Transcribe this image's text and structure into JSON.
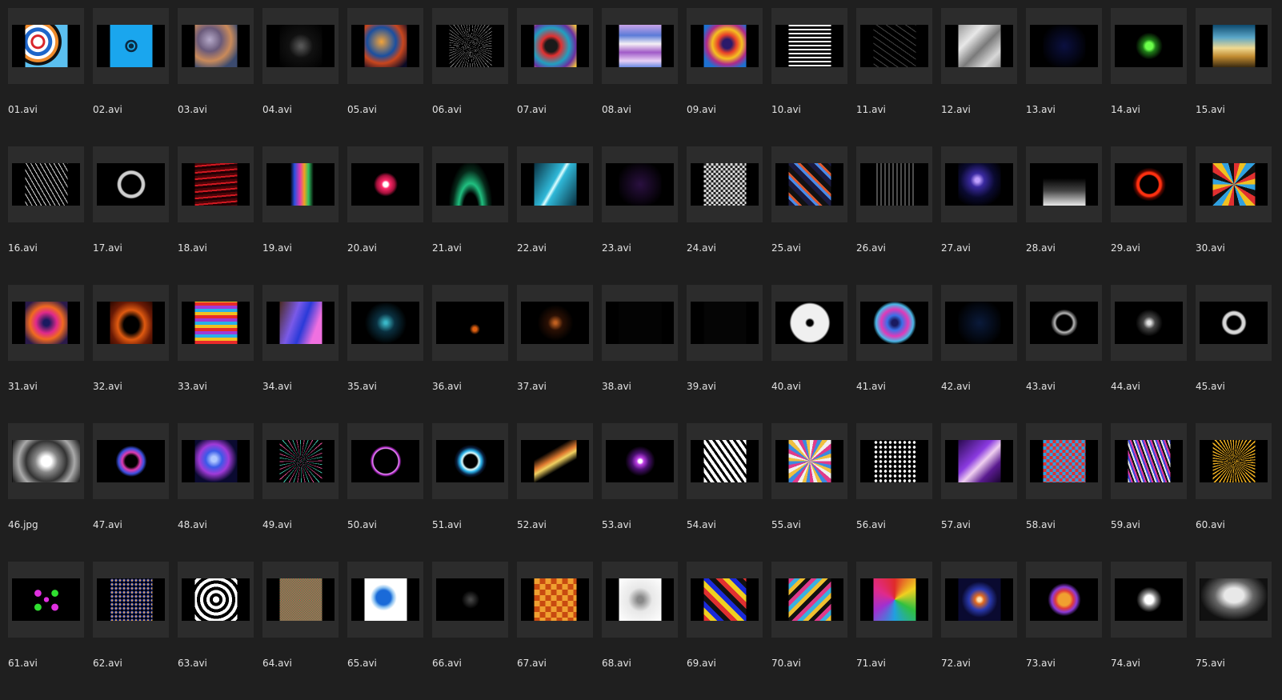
{
  "files": [
    {
      "name": "01.avi",
      "art": "thumbnail-art",
      "bg": "radial-gradient(circle at 30% 40%, #ffffff 0 12%, #d8252a 13% 18%, #ffffff 19% 26%, #1e66c9 27% 36%, #ffffff 37% 44%, #ef8b2c 45% 52%, #111 53% 60%, #5bc0f0 61% 100%)"
    },
    {
      "name": "02.avi",
      "art": "thumbnail-art",
      "bg": "radial-gradient(circle, #0a2a40 0 8%, #1aa8e8 9% 13%, #0b2b44 14% 20%, #1aa6ee 21% 100%)"
    },
    {
      "name": "03.avi",
      "art": "thumbnail-art",
      "bg": "radial-gradient(circle at 35% 35%, #b5a9c9, #6a5a7a 30%, #c98a5a 55%, #3b4a6e 80%)"
    },
    {
      "name": "04.avi",
      "art": "thumbnail-art",
      "bg": "radial-gradient(circle at 50% 50%, #555 0 5%, #111 40%, #000 100%)"
    },
    {
      "name": "05.avi",
      "art": "thumbnail-art",
      "bg": "radial-gradient(circle at 40% 40%, #f2a33a, #1a4fa0 40%, #c8461d 60%, #0a0a24 90%)"
    },
    {
      "name": "06.avi",
      "art": "thumbnail-art",
      "bg": "repeating-conic-gradient(from 0deg, #000 0 6deg, #bbb 6deg 7deg)"
    },
    {
      "name": "07.avi",
      "art": "thumbnail-art",
      "bg": "radial-gradient(circle at 40% 50%, #1a1a1a 0 18%, #e03030 30%, #20a0c0 55%, #6b2fa0 75%, #f0c040 95%)"
    },
    {
      "name": "08.avi",
      "art": "thumbnail-art",
      "bg": "linear-gradient(180deg, #c9a3e8, #5b7bd8 25%, #f5f0f5 45%, #a05ac8 65%, #e8d0f5 85%, #6b8ae0)"
    },
    {
      "name": "09.avi",
      "art": "thumbnail-art",
      "bg": "radial-gradient(circle at 55% 45%, #2a1a6a 0 14%, #e8402a 28%, #f5c020 45%, #b02a8a 62%, #1e70d0 80%)"
    },
    {
      "name": "10.avi",
      "art": "thumbnail-art",
      "bg": "repeating-linear-gradient(180deg, #ffffff 0 2px, #000 2px 5px)"
    },
    {
      "name": "11.avi",
      "art": "thumbnail-art",
      "bg": "repeating-linear-gradient(35deg, #000 0 3px, #444 3px 4px, #000 4px 7px)"
    },
    {
      "name": "12.avi",
      "art": "thumbnail-art",
      "bg": "linear-gradient(135deg, #9a9a9a, #e8e8e8 30%, #7a7a7a 55%, #d8d8d8 80%, #8a8a8a)"
    },
    {
      "name": "13.avi",
      "art": "thumbnail-art",
      "bg": "radial-gradient(circle at 50% 50%, #0b1040, #000 80%)"
    },
    {
      "name": "14.avi",
      "art": "thumbnail-art",
      "bg": "radial-gradient(circle at 50% 50%, #6bff4a 0 12%, #1f7a18 22%, #000 45%)"
    },
    {
      "name": "15.avi",
      "art": "thumbnail-art",
      "bg": "linear-gradient(180deg, #0d4a6e, #5aa6c8 30%, #f0d890 55%, #c08a30 75%, #3a2a10)"
    },
    {
      "name": "16.avi",
      "art": "thumbnail-art",
      "bg": "repeating-linear-gradient(60deg, #000 0 2px, #d8d8d8 2px 3px, #000 3px 5px)"
    },
    {
      "name": "17.avi",
      "art": "thumbnail-art",
      "bg": "radial-gradient(circle at 50% 50%, #000 0 32%, #cfcfcf 36% 44%, #000 48%)"
    },
    {
      "name": "18.avi",
      "art": "thumbnail-art",
      "bg": "repeating-linear-gradient(175deg, #4a0508 0 3px, #d01820 3px 5px, #200004 5px 8px)"
    },
    {
      "name": "19.avi",
      "art": "thumbnail-art",
      "bg": "linear-gradient(90deg, #000 0 25%, #2a50e0 35%, #e03ab0 48%, #f0a020 58%, #30c060 68%, #000 80%)"
    },
    {
      "name": "20.avi",
      "art": "thumbnail-art",
      "bg": "radial-gradient(circle at 50% 50%, #ffffff 0 8%, #ff2a6a 14%, #a0103a 30%, #000 40%)"
    },
    {
      "name": "21.avi",
      "art": "thumbnail-art",
      "bg": "radial-gradient(ellipse at 50% 110%, #000 0 25%, #20c080 40%, #062a1a 60%, #000 75%)"
    },
    {
      "name": "22.avi",
      "art": "thumbnail-art",
      "bg": "linear-gradient(120deg, #0a3040, #2fb8d8 45%, #e0ffff 50%, #2fb8d8 55%, #0a3040)"
    },
    {
      "name": "23.avi",
      "art": "thumbnail-art",
      "bg": "radial-gradient(circle at 50% 50%, #2a1040, #000 80%)"
    },
    {
      "name": "24.avi",
      "art": "thumbnail-art",
      "bg": "repeating-conic-gradient(#d8d8d8 0 25%, #222 0 50%) 0 0 / 6px 6px"
    },
    {
      "name": "25.avi",
      "art": "thumbnail-art",
      "bg": "repeating-linear-gradient(45deg, #1a1a40 0 6px, #4a8ae8 6px 9px, #e05a30 9px 12px, #111 12px 18px)"
    },
    {
      "name": "26.avi",
      "art": "thumbnail-art",
      "bg": "repeating-linear-gradient(90deg, #000 0 4px, #9a9a9a 4px 5px)"
    },
    {
      "name": "27.avi",
      "art": "thumbnail-art",
      "bg": "radial-gradient(circle at 45% 40%, #c0a0ff 0 6%, #3a2aa0 20%, #0a0a30 50%, #000 80%)"
    },
    {
      "name": "28.avi",
      "art": "thumbnail-art",
      "bg": "linear-gradient(180deg, #000 0 35%, #444 65%, #e8e8e8 100%)"
    },
    {
      "name": "29.avi",
      "art": "thumbnail-art",
      "bg": "radial-gradient(circle at 50% 50%, #000 0 30%, #ff3010 34% 40%, #600800 46%, #000 56%)"
    },
    {
      "name": "30.avi",
      "art": "thumbnail-art",
      "bg": "repeating-conic-gradient(from 0deg, #e03030 0 15deg, #f0c020 15deg 30deg, #30a0e0 30deg 45deg, #111 45deg 60deg)"
    },
    {
      "name": "31.avi",
      "art": "thumbnail-art",
      "bg": "radial-gradient(circle at 50% 50%, #1a1a60 0 10%, #e02a8a 35%, #f06a20 55%, #2a1a4a 85%)"
    },
    {
      "name": "32.avi",
      "art": "thumbnail-art",
      "bg": "radial-gradient(ellipse at 50% 55%, #000 0 25%, #e05a10 45%, #6a1a05 70%, #2a0800 100%)"
    },
    {
      "name": "33.avi",
      "art": "thumbnail-art",
      "bg": "repeating-linear-gradient(0deg, #e82a2a 0 4px, #f0c020 4px 8px, #2ab0e8 8px 12px, #a03ad8 12px 16px)"
    },
    {
      "name": "34.avi",
      "art": "thumbnail-art",
      "bg": "linear-gradient(110deg, #4a2a20, #7a5ae8 35%, #2a3ad8 55%, #f070e0 80%)"
    },
    {
      "name": "35.avi",
      "art": "thumbnail-art",
      "bg": "radial-gradient(circle at 50% 50%, #3ab8c8 0 4%, #0a3040 30%, #000 70%)"
    },
    {
      "name": "36.avi",
      "art": "thumbnail-art",
      "bg": "radial-gradient(circle at 60% 65%, #e06010 0 5%, #000 14%)"
    },
    {
      "name": "37.avi",
      "art": "thumbnail-art",
      "bg": "radial-gradient(circle at 50% 50%, #c06020 0 4%, #2a1004 25%, #000 60%)"
    },
    {
      "name": "38.avi",
      "art": "thumbnail-art",
      "bg": "#030303"
    },
    {
      "name": "39.avi",
      "art": "thumbnail-art",
      "bg": "#050505"
    },
    {
      "name": "40.avi",
      "art": "thumbnail-art",
      "bg": "radial-gradient(circle at 50% 50%, #000 0 10%, #f0f0f0 16% 62%, #000 68%)"
    },
    {
      "name": "41.avi",
      "art": "thumbnail-art",
      "bg": "radial-gradient(circle at 50% 50%, #1a1a60 0 10%, #3a70e8 25%, #e03ab8 45%, #4ab8e8 62%, #000 72%)"
    },
    {
      "name": "42.avi",
      "art": "thumbnail-art",
      "bg": "radial-gradient(ellipse at 50% 50%, #0a1a3a, #000 80%)"
    },
    {
      "name": "43.avi",
      "art": "thumbnail-art",
      "bg": "radial-gradient(circle at 50% 50%, #000 0 25%, #b8b8b8 32%, #000 45%)"
    },
    {
      "name": "44.avi",
      "art": "thumbnail-art",
      "bg": "radial-gradient(circle at 50% 50%, #e0e0e0 0 6%, #444 20%, #000 45%)"
    },
    {
      "name": "45.avi",
      "art": "thumbnail-art",
      "bg": "radial-gradient(circle at 50% 50%, #000 0 22%, #d8d8d8 28% 36%, #000 42%)"
    },
    {
      "name": "46.jpg",
      "art": "thumbnail-art",
      "bg": "radial-gradient(circle at 50% 50%, #ffffff 0 10%, #888 22%, #333 40%, #aaa 55%, #222 75%, #666 100%)",
      "shape": "tall"
    },
    {
      "name": "47.avi",
      "art": "thumbnail-art",
      "bg": "radial-gradient(circle at 50% 50%, #000 0 20%, #e03ab0 30%, #3a50e0 42%, #000 52%)"
    },
    {
      "name": "48.avi",
      "art": "thumbnail-art",
      "bg": "radial-gradient(circle at 45% 45%, #b0c8ff 0 8%, #3a5ae8 25%, #a03ad8 45%, #0a0a30 70%)"
    },
    {
      "name": "49.avi",
      "art": "thumbnail-art",
      "bg": "repeating-conic-gradient(from 0deg, #000 0 8deg, #d84a8a 8deg 10deg, #000 10deg 18deg, #3ab8a0 18deg 20deg)"
    },
    {
      "name": "50.avi",
      "art": "thumbnail-art",
      "bg": "radial-gradient(circle at 50% 50%, #000 0 40%, #f0a0ff 43%, #c030d8 46%, #000 52%)"
    },
    {
      "name": "51.avi",
      "art": "thumbnail-art",
      "bg": "radial-gradient(circle at 50% 50%, #000 0 22%, #e0ffff 28%, #2ab0e8 36%, #0a2040 46%, #000 55%)"
    },
    {
      "name": "52.avi",
      "art": "thumbnail-art",
      "bg": "linear-gradient(150deg, #000 0 30%, #e07a30 45%, #f0d060 52%, #000 65%)"
    },
    {
      "name": "53.avi",
      "art": "thumbnail-art",
      "bg": "radial-gradient(circle at 50% 50%, #ffffff 0 6%, #c040e8 12%, #4a1070 28%, #000 50%)"
    },
    {
      "name": "54.avi",
      "art": "thumbnail-art",
      "bg": "repeating-linear-gradient(55deg, #fff 0 4px, #000 4px 7px)"
    },
    {
      "name": "55.avi",
      "art": "thumbnail-art",
      "bg": "repeating-conic-gradient(from 0deg, #f0f0f0 0 10deg, #e03a8a 10deg 20deg, #3a8ae0 20deg 30deg, #f0c040 30deg 40deg)"
    },
    {
      "name": "56.avi",
      "art": "thumbnail-art",
      "bg": "radial-gradient(circle, #fff 0 40%, #000 45%) 0 0 / 6px 6px"
    },
    {
      "name": "57.avi",
      "art": "thumbnail-art",
      "bg": "linear-gradient(135deg, #2a0a50, #8a3ae0 40%, #f0d0f0 55%, #5a1a90 75%, #1a0530)"
    },
    {
      "name": "58.avi",
      "art": "thumbnail-art",
      "bg": "repeating-conic-gradient(#e03030 0 25%, #30a0e0 0 50%) 0 0 / 8px 8px"
    },
    {
      "name": "59.avi",
      "art": "thumbnail-art",
      "bg": "repeating-linear-gradient(70deg, #e8e8e8 0 2px, #3a4ae0 2px 4px, #e03aa0 4px 6px, #111 6px 8px)"
    },
    {
      "name": "60.avi",
      "art": "thumbnail-art",
      "bg": "repeating-conic-gradient(from 0deg, #000 0 5deg, #f0b020 5deg 8deg)"
    },
    {
      "name": "61.avi",
      "art": "thumbnail-art",
      "bg": "radial-gradient(circle at 30% 35%, #e030e0 0 8%, transparent 9%), radial-gradient(circle at 70% 35%, #30e030 0 8%, transparent 9%), radial-gradient(circle at 50% 50%, #e030e0 0 8%, transparent 9%), radial-gradient(circle at 30% 68%, #30e030 0 8%, transparent 9%), radial-gradient(circle at 70% 68%, #e030e0 0 8%, #000 9%)"
    },
    {
      "name": "62.avi",
      "art": "thumbnail-art",
      "bg": "radial-gradient(circle, #e0a030 0 30%, #3a50e0 35% 50%, #000 55%) 0 0 / 5px 5px"
    },
    {
      "name": "63.avi",
      "art": "thumbnail-art",
      "bg": "repeating-radial-gradient(circle at 50% 50%, #fff 0 4px, #000 4px 8px)"
    },
    {
      "name": "64.avi",
      "art": "thumbnail-art",
      "bg": "repeating-conic-gradient(#d84a4a 0 25%, #3a9a5a 0 50%) 0 0 / 3px 3px"
    },
    {
      "name": "65.avi",
      "art": "thumbnail-art",
      "bg": "radial-gradient(circle at 45% 45%, #1a6ad8 0 22%, #8ac0f0 30%, #ffffff 40%)"
    },
    {
      "name": "66.avi",
      "art": "thumbnail-art",
      "bg": "radial-gradient(circle at 50% 50%, #444 0 3%, #000 30%)"
    },
    {
      "name": "67.avi",
      "art": "thumbnail-art",
      "bg": "repeating-conic-gradient(#c84a10 0 25%, #f0a030 0 50%) 0 0 / 14px 14px"
    },
    {
      "name": "68.avi",
      "art": "thumbnail-art",
      "bg": "radial-gradient(circle at 50% 50%, #888 0 10%, #e8e8e8 40%, #ffffff 100%)"
    },
    {
      "name": "69.avi",
      "art": "thumbnail-art",
      "bg": "repeating-linear-gradient(45deg, #e03030 0 6px, #f0d020 6px 12px, #1a2ad8 12px 18px, #111 18px 24px)"
    },
    {
      "name": "70.avi",
      "art": "thumbnail-art",
      "bg": "repeating-linear-gradient(135deg, #e03a8a 0 5px, #3ab0e0 5px 10px, #f0c030 10px 15px, #111 15px 20px)"
    },
    {
      "name": "71.avi",
      "art": "thumbnail-art",
      "bg": "conic-gradient(from 0deg, #e02a2a, #f0d020, #30c040, #20a0e0, #a030d0, #e02a8a, #e02a2a)"
    },
    {
      "name": "72.avi",
      "art": "thumbnail-art",
      "bg": "radial-gradient(circle at 50% 50%, #ffe0b0 0 6%, #e06a20 15%, #2a3ab0 35%, #0a0a30 60%)"
    },
    {
      "name": "73.avi",
      "art": "thumbnail-art",
      "bg": "radial-gradient(circle at 50% 50%, #f0a030 0 20%, #e03a3a 30%, #8a3ad8 42%, #000 55%)"
    },
    {
      "name": "74.avi",
      "art": "thumbnail-art",
      "bg": "radial-gradient(circle at 50% 50%, #ffffff 0 14%, #888 24%, #000 42%)"
    },
    {
      "name": "75.avi",
      "art": "thumbnail-art",
      "bg": "radial-gradient(ellipse at 50% 40%, #e8e8e8 0 20%, #666 40%, #111 70%)",
      "shape": "wide"
    }
  ]
}
